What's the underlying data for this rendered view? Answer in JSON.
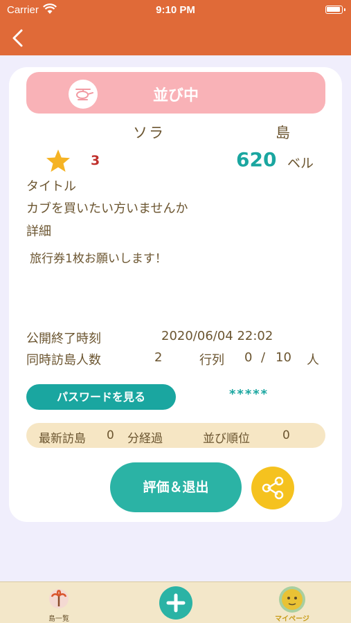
{
  "status_bar": {
    "carrier": "Carrier",
    "time": "9:10 PM"
  },
  "card": {
    "status_label": "並び中",
    "resident_name": "ソラ",
    "island_suffix": "島",
    "rating": "3",
    "price": "620",
    "price_unit": "ベル",
    "title_label": "タイトル",
    "title_value": "カブを買いたい方いませんか",
    "detail_label": "詳細",
    "detail_value": "旅行券1枚お願いします！",
    "end_time_label": "公開終了時刻",
    "end_time_value": "2020/06/04 22:02",
    "visitors_label": "同時訪島人数",
    "visitors_value": "2",
    "queue_label": "行列",
    "queue_current": "0",
    "queue_separator": "/",
    "queue_max": "10",
    "queue_unit": "人",
    "password_button": "パスワードを見る",
    "password_mask": "*****",
    "latest_visit_label": "最新訪島",
    "latest_visit_minutes": "0",
    "minutes_elapsed_label": "分経過",
    "queue_rank_label": "並び順位",
    "queue_rank_value": "0",
    "evaluate_exit_button": "評価＆退出"
  },
  "tabs": [
    {
      "label": "島一覧"
    },
    {
      "label": ""
    },
    {
      "label": "マイページ"
    }
  ],
  "colors": {
    "nav": "#e06a38",
    "status_pill": "#f9b2b7",
    "teal": "#1aa6a0",
    "share": "#f5c21f",
    "tab_bar": "#f3e7c9",
    "page_bg": "#f0eefc"
  },
  "icons": [
    "wifi-icon",
    "battery-icon",
    "back-chevron-icon",
    "helicopter-icon",
    "star-icon",
    "share-icon",
    "palm-tree-icon",
    "plus-icon",
    "villager-avatar-icon"
  ]
}
